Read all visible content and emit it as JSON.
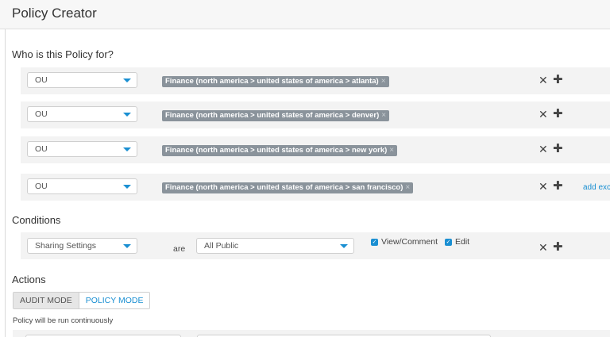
{
  "header": {
    "title": "Policy Creator"
  },
  "who_section": {
    "title": "Who is this Policy for?",
    "rows": [
      {
        "select_value": "OU",
        "tag": "Finance (north america > united states of america > atlanta)"
      },
      {
        "select_value": "OU",
        "tag": "Finance (north america > united states of america > denver)"
      },
      {
        "select_value": "OU",
        "tag": "Finance (north america > united states of america > new york)"
      },
      {
        "select_value": "OU",
        "tag": "Finance (north america > united states of america > san francisco)"
      }
    ],
    "add_link": "add exc"
  },
  "conditions": {
    "title": "Conditions",
    "field_select": "Sharing Settings",
    "operator": "are",
    "value_select": "All Public",
    "checkboxes": [
      {
        "label": "View/Comment",
        "checked": true
      },
      {
        "label": "Edit",
        "checked": true
      }
    ]
  },
  "actions": {
    "title": "Actions",
    "modes": [
      "AUDIT MODE",
      "POLICY MODE"
    ],
    "active_mode": "POLICY MODE",
    "note": "Policy will be run continuously"
  },
  "icons": {
    "remove": "✕",
    "add": "✚",
    "tag_remove": "×",
    "check": "✓"
  },
  "colors": {
    "accent": "#1a8fd2",
    "tag_bg": "#8a939b",
    "row_bg": "#f3f3f3"
  }
}
